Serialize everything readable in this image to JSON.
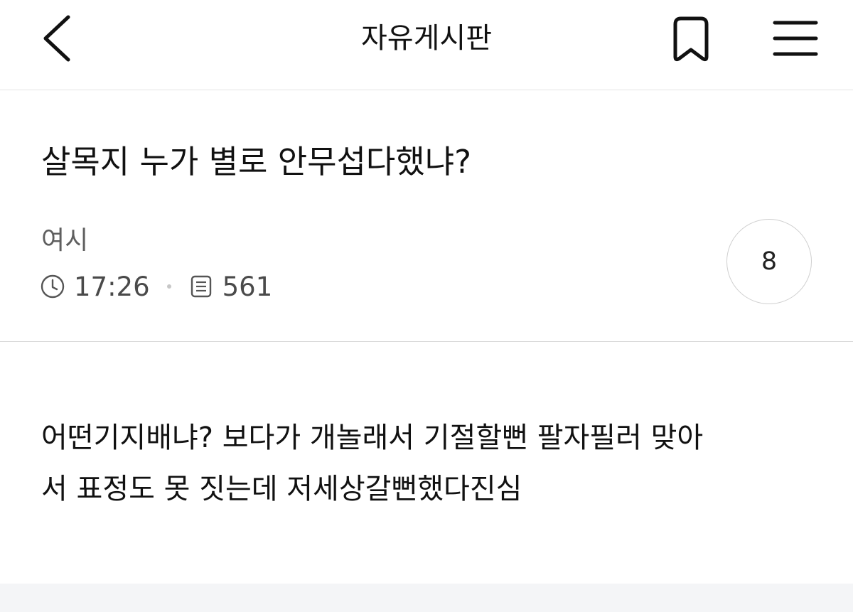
{
  "header": {
    "back_icon": "chevron-left-icon",
    "board_name": "자유게시판",
    "bookmark_icon": "bookmark-icon",
    "menu_icon": "hamburger-menu-icon"
  },
  "post": {
    "title": "살목지 누가 별로 안무섭다했냐?",
    "author": "여시",
    "time": "17:26",
    "views": "561",
    "comment_count": "8",
    "body_lines": [
      "어떤기지배냐? 보다가 개놀래서 기절할뻔 팔자필러 맞아",
      "서 표정도 못 짓는데 저세상갈뻔했다진심"
    ]
  },
  "colors": {
    "text": "#111111",
    "muted": "#5f5f5f",
    "divider": "#d9d9d9",
    "footer": "#f4f5f7"
  }
}
